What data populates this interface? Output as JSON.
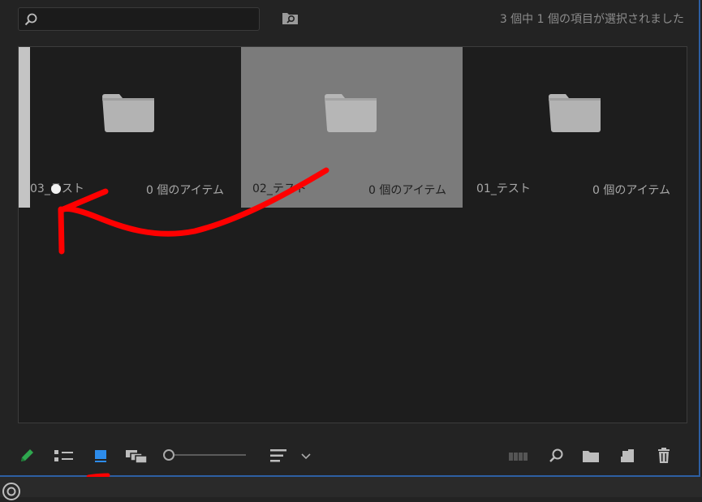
{
  "search": {
    "placeholder": "",
    "value": ""
  },
  "status": {
    "selection_text": "3 個中 1 個の項目が選択されました"
  },
  "items": [
    {
      "name": "03_テスト",
      "count": "0 個のアイテム",
      "selected": false
    },
    {
      "name": "02_テスト",
      "count": "0 個のアイテム",
      "selected": true
    },
    {
      "name": "01_テスト",
      "count": "0 個のアイテム",
      "selected": false
    }
  ],
  "toolbar": {
    "tools": [
      "pencil-icon",
      "list-view-icon",
      "icon-view-icon",
      "freeform-view-icon",
      "zoom-slider",
      "sort-icon",
      "chevron-down-icon",
      "automate-to-sequence-icon",
      "find-icon",
      "new-bin-icon",
      "new-item-icon",
      "trash-icon"
    ],
    "active_view": "icon-view",
    "zoom_level": 0
  },
  "colors": {
    "panel_bg": "#232323",
    "grid_bg": "#1d1d1d",
    "selection": "#7b7b7b",
    "accent_blue": "#2d8ceb",
    "pencil_green": "#2fa84f",
    "annotation_red": "#ff0000"
  }
}
